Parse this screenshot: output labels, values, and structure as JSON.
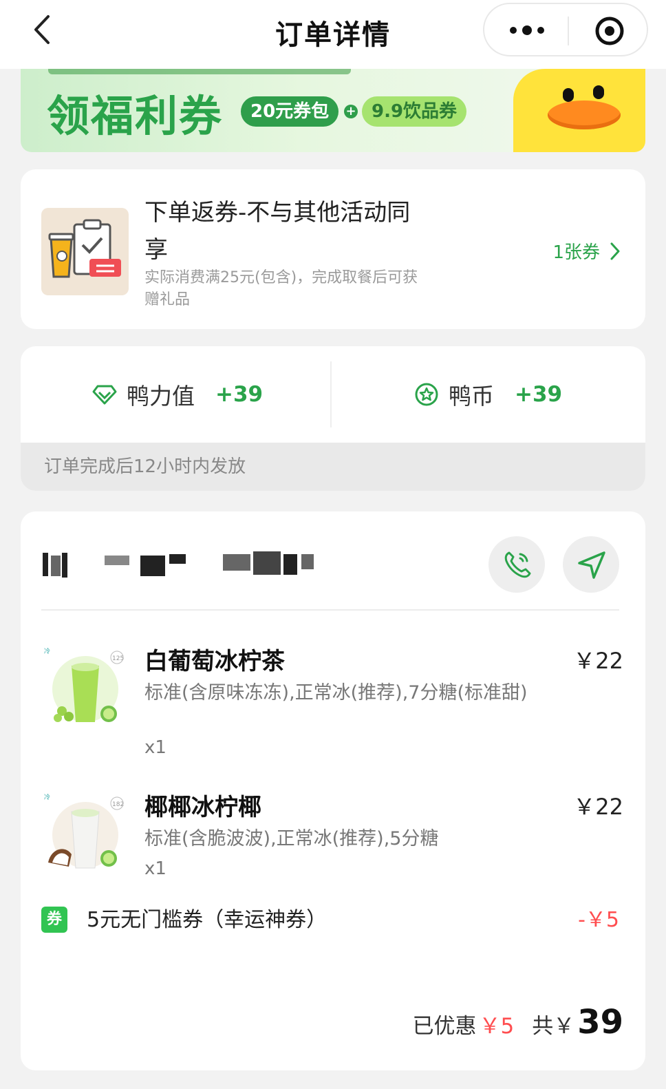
{
  "nav": {
    "title": "订单详情",
    "back_icon": "chevron-left-icon",
    "more_icon": "more-dots-icon",
    "close_icon": "target-icon"
  },
  "banner": {
    "title": "领福利券",
    "pill_a": "20元券包",
    "plus": "+",
    "pill_b": "9.9饮品券"
  },
  "coupon_promo": {
    "title": "下单返券-不与其他活动同享",
    "desc": "实际消费满25元(包含)，完成取餐后可获赠礼品",
    "count": "1张券"
  },
  "points": {
    "items": [
      {
        "label": "鸭力值",
        "value": "+39",
        "icon": "diamond-icon"
      },
      {
        "label": "鸭币",
        "value": "+39",
        "icon": "star-coin-icon"
      }
    ],
    "note": "订单完成后12小时内发放"
  },
  "order": {
    "store_icons": {
      "phone": "phone-icon",
      "navigate": "navigate-icon"
    },
    "items": [
      {
        "name": "白葡萄冰柠茶",
        "spec": "标准(含原味冻冻),正常冰(推荐),7分糖(标准甜)",
        "qty": "x1",
        "price": "￥22",
        "cal": "125"
      },
      {
        "name": "椰椰冰柠椰",
        "spec": "标准(含脆波波),正常冰(推荐),5分糖",
        "qty": "x1",
        "price": "￥22",
        "cal": "182"
      }
    ],
    "coupon": {
      "badge": "券",
      "name": "5元无门槛券（幸运神券）",
      "amount": "-￥5"
    },
    "summary": {
      "discount_label": "已优惠",
      "discount": "￥5",
      "total_label": "共￥",
      "total": "39"
    }
  },
  "colors": {
    "accent": "#2aa34a",
    "price_red": "#ff4d4f",
    "banner_green": "#2aa34a",
    "duck_yellow": "#ffe33b"
  }
}
